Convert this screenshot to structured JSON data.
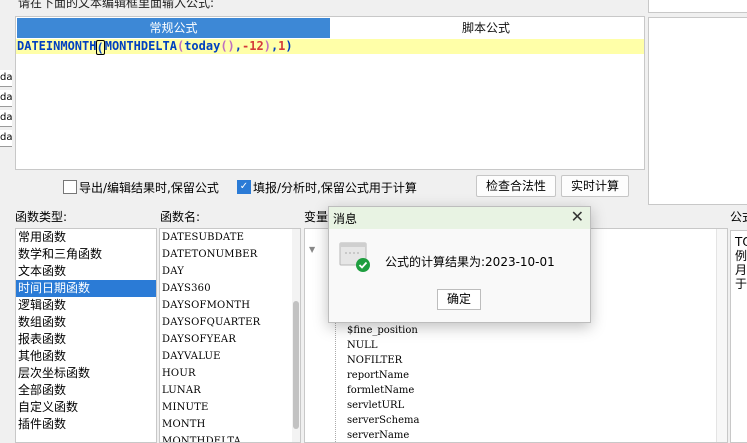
{
  "prompt": "请在下面的文本编辑框里面输入公式:",
  "left_strip": [
    "da",
    "da",
    "da",
    "da"
  ],
  "editor": {
    "tabs": [
      {
        "label": "常规公式",
        "active": true
      },
      {
        "label": "脚本公式",
        "active": false
      }
    ],
    "formula": {
      "fn1": "DATEINMONTH",
      "open1": "(",
      "fn2": "MONTHDELTA",
      "open2": "(",
      "fn3": "today",
      "empty_parens": "()",
      "comma1": ",",
      "num1": "-12",
      "close2": ")",
      "comma2": ",",
      "num2": "1",
      "close1": ")"
    }
  },
  "options": {
    "export_keep": {
      "label": "导出/编辑结果时,保留公式",
      "checked": false
    },
    "fill_keep": {
      "label": "填报/分析时,保留公式用于计算",
      "checked": true
    },
    "validate_button": "检查合法性",
    "realtime_button": "实时计算"
  },
  "labels": {
    "fn_type": "函数类型:",
    "fn_name": "函数名:",
    "variables": "变量",
    "description": "公式"
  },
  "fn_types": [
    {
      "label": "常用函数",
      "selected": false
    },
    {
      "label": "数学和三角函数",
      "selected": false
    },
    {
      "label": "文本函数",
      "selected": false
    },
    {
      "label": "时间日期函数",
      "selected": true
    },
    {
      "label": "逻辑函数",
      "selected": false
    },
    {
      "label": "数组函数",
      "selected": false
    },
    {
      "label": "报表函数",
      "selected": false
    },
    {
      "label": "其他函数",
      "selected": false
    },
    {
      "label": "层次坐标函数",
      "selected": false
    },
    {
      "label": "全部函数",
      "selected": false
    },
    {
      "label": "自定义函数",
      "selected": false
    },
    {
      "label": "插件函数",
      "selected": false
    }
  ],
  "fn_names": [
    "DATESUBDATE",
    "DATETONUMBER",
    "DAY",
    "DAYS360",
    "DAYSOFMONTH",
    "DAYSOFQUARTER",
    "DAYSOFYEAR",
    "DAYVALUE",
    "HOUR",
    "LUNAR",
    "MINUTE",
    "MONTH",
    "MONTHDELTA"
  ],
  "variables": [
    "$fine_position",
    "NULL",
    "NOFILTER",
    "reportName",
    "formletName",
    "servletURL",
    "serverSchema",
    "serverName"
  ],
  "right_desc": [
    "TO",
    "例",
    "月",
    "于"
  ],
  "dialog": {
    "title": "消息",
    "close_symbol": "✕",
    "message": "公式的计算结果为:2023-10-01",
    "ok_label": "确定",
    "icon": "success-check-icon"
  },
  "colors": {
    "accent": "#3d88d6",
    "selection": "#2b7bd6",
    "formula_bg": "#ffffa8",
    "success": "#1e9e3f",
    "dialog_title_bg": "#e8f3e3"
  }
}
